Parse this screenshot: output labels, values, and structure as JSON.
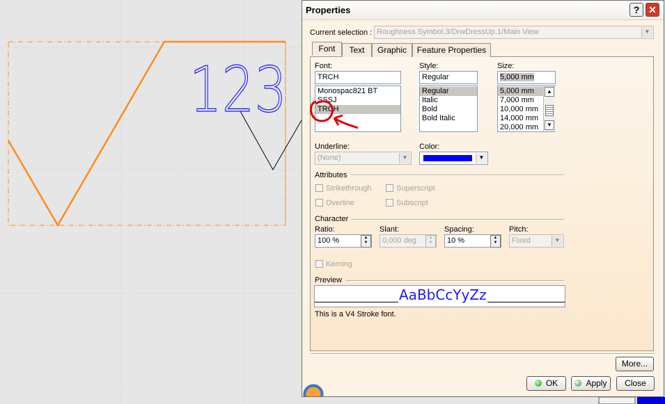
{
  "canvas": {
    "symbol_text": "123",
    "colors": {
      "highlight": "#ff8c1a",
      "text": "#1a1aff",
      "annotation": "#e00000"
    }
  },
  "dialog": {
    "title": "Properties",
    "help_label": "?",
    "close_label": "✕",
    "current_selection_label": "Current selection :",
    "current_selection_value": "Roughness Symbol.3/DrwDressUp.1/Main View",
    "tabs": [
      {
        "label": "Font",
        "active": true
      },
      {
        "label": "Text",
        "active": false
      },
      {
        "label": "Graphic",
        "active": false
      },
      {
        "label": "Feature Properties",
        "active": false
      }
    ],
    "font": {
      "label": "Font:",
      "value": "TRCH",
      "items": [
        "Monospac821 BT",
        "SSSJ",
        "TRCH"
      ],
      "selected": "TRCH"
    },
    "style": {
      "label": "Style:",
      "value": "Regular",
      "items": [
        "Regular",
        "Italic",
        "Bold",
        "Bold Italic"
      ],
      "selected": "Regular"
    },
    "size": {
      "label": "Size:",
      "value": "5,000 mm",
      "items": [
        "5,000 mm",
        "7,000 mm",
        "10,000 mm",
        "14,000 mm",
        "20,000 mm"
      ],
      "selected": "5,000 mm"
    },
    "underline": {
      "label": "Underline:",
      "value": "(None)"
    },
    "color": {
      "label": "Color:",
      "value": "#0000ff"
    },
    "attributes": {
      "title": "Attributes",
      "strikethrough": "Strikethrough",
      "superscript": "Superscript",
      "overline": "Overline",
      "subscript": "Subscript"
    },
    "character": {
      "title": "Character",
      "ratio_label": "Ratio:",
      "ratio_value": "100 %",
      "slant_label": "Slant:",
      "slant_value": "0,000 deg",
      "spacing_label": "Spacing:",
      "spacing_value": "10 %",
      "pitch_label": "Pitch:",
      "pitch_value": "Fixed",
      "kerning": "Kerning"
    },
    "preview": {
      "title": "Preview",
      "sample": "AaBbCcYyZz",
      "description": "This is a V4 Stroke font."
    },
    "buttons": {
      "more": "More...",
      "ok": "OK",
      "apply": "Apply",
      "close": "Close"
    }
  }
}
